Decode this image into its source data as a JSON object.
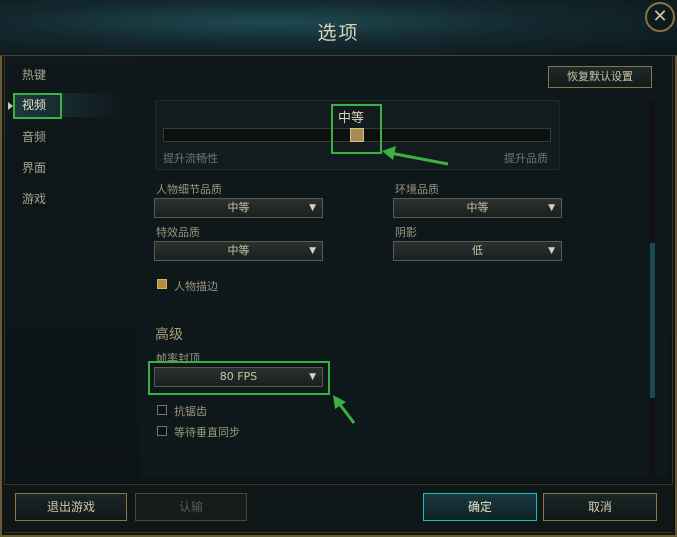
{
  "window": {
    "title": "选项"
  },
  "icons": {
    "close": "close-icon",
    "dropdown": "chevron-down-icon"
  },
  "sidebar": {
    "items": [
      {
        "label": "热键"
      },
      {
        "label": "视频"
      },
      {
        "label": "音频"
      },
      {
        "label": "界面"
      },
      {
        "label": "游戏"
      }
    ],
    "active": "视频"
  },
  "toolbar": {
    "reset_label": "恢复默认设置"
  },
  "quality": {
    "label": "中等",
    "left_label": "提升流畅性",
    "right_label": "提升品质",
    "value_fraction": 0.5
  },
  "settings": {
    "character_detail": {
      "label": "人物细节品质",
      "value": "中等"
    },
    "environment": {
      "label": "环境品质",
      "value": "中等"
    },
    "effects": {
      "label": "特效品质",
      "value": "中等"
    },
    "shadows": {
      "label": "阴影",
      "value": "低"
    },
    "outline": {
      "label": "人物描边",
      "checked": true
    }
  },
  "advanced": {
    "title": "高级",
    "frame_cap": {
      "label": "帧率封顶",
      "value": "80 FPS"
    },
    "antialias": {
      "label": "抗锯齿",
      "checked": false
    },
    "vsync": {
      "label": "等待垂直同步",
      "checked": false
    }
  },
  "footer": {
    "exit": "退出游戏",
    "surrender": "认输",
    "ok": "确定",
    "cancel": "取消"
  },
  "colors": {
    "accent": "#0ac8b9",
    "gold": "#8a7441",
    "highlight": "#3cb043"
  }
}
